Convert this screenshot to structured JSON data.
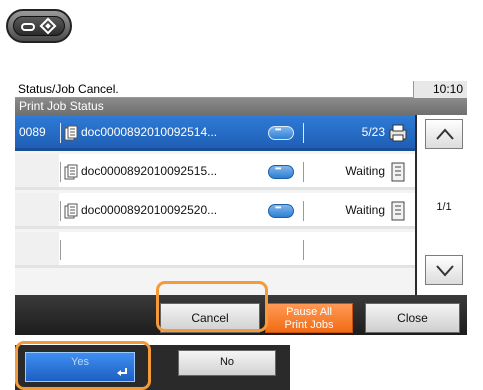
{
  "titlebar": {
    "title": "Status/Job Cancel.",
    "time": "10:10"
  },
  "subtitle": "Print Job Status",
  "jobs": [
    {
      "number": "0089",
      "name": "doc0000892010092514...",
      "status": "5/23",
      "selected": true
    },
    {
      "number": "",
      "name": "doc0000892010092515...",
      "status": "Waiting",
      "selected": false
    },
    {
      "number": "",
      "name": "doc0000892010092520...",
      "status": "Waiting",
      "selected": false
    }
  ],
  "scroll": {
    "page": "1/1"
  },
  "buttons": {
    "cancel": "Cancel",
    "pause_line1": "Pause All",
    "pause_line2": "Print Jobs",
    "close": "Close"
  },
  "confirm": {
    "yes": "Yes",
    "no": "No"
  },
  "colors": {
    "accent": "#2f7bd7",
    "highlight": "#f39a3a",
    "pause": "#f26b15"
  },
  "icons": [
    "status-job-cancel-key-icon",
    "document-stack-icon",
    "details-icon",
    "printing-icon",
    "waiting-queue-icon",
    "scroll-up-icon",
    "scroll-down-icon",
    "enter-icon"
  ]
}
